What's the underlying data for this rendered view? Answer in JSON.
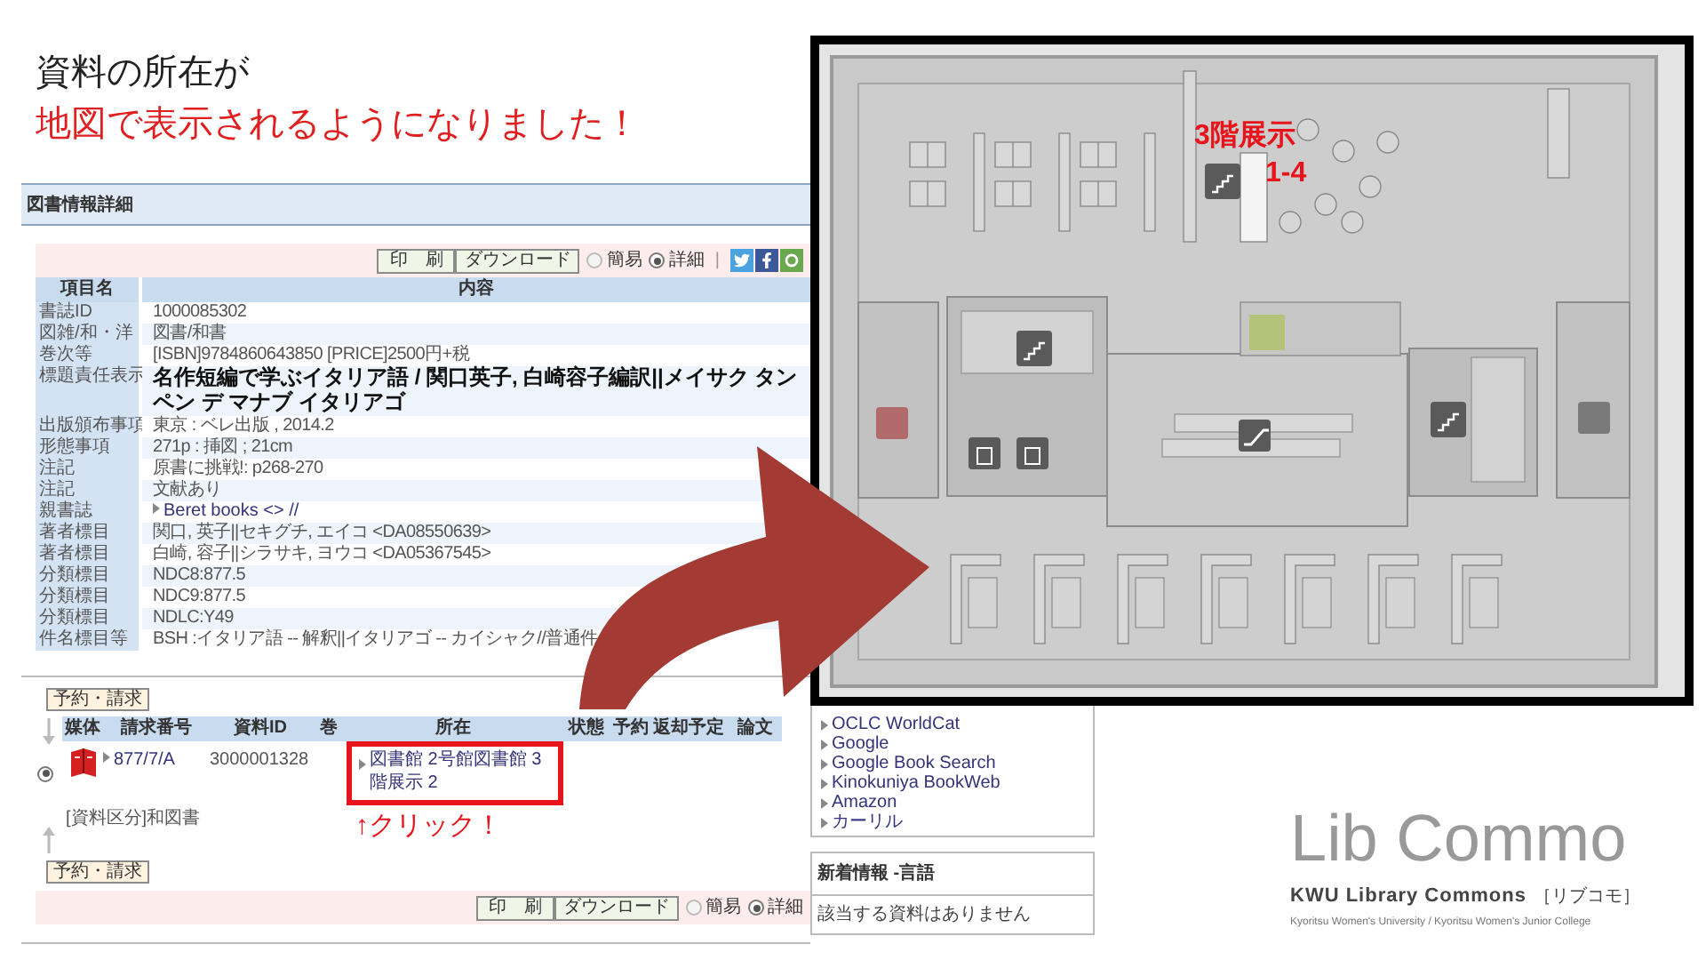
{
  "heading": {
    "line1": "資料の所在が",
    "line2": "地図で表示されるようになりました！"
  },
  "catalog": {
    "title": "図書情報詳細",
    "toolbar": {
      "print": "印　刷",
      "download": "ダウンロード",
      "views": [
        {
          "label": "簡易",
          "selected": false
        },
        {
          "label": "詳細",
          "selected": true
        }
      ],
      "separator": "|"
    },
    "columns": [
      "項目名",
      "内容"
    ],
    "rows": [
      {
        "kind": "text",
        "label": "書誌ID",
        "value": "1000085302"
      },
      {
        "kind": "text",
        "label": "図雑/和・洋",
        "value": "図書/和書"
      },
      {
        "kind": "text",
        "label": "巻次等",
        "value": "[ISBN]9784860643850 [PRICE]2500円+税"
      },
      {
        "kind": "title",
        "label": "標題責任表示",
        "value": "名作短編で学ぶイタリア語 / 関口英子, 白崎容子編訳||メイサク タンペン デ マナブ イタリアゴ"
      },
      {
        "kind": "text",
        "label": "出版頒布事項",
        "value": "東京 : ベレ出版 , 2014.2"
      },
      {
        "kind": "text",
        "label": "形態事項",
        "value": "271p : 挿図 ; 21cm"
      },
      {
        "kind": "text",
        "label": "注記",
        "value": "原書に挑戦!: p268-270"
      },
      {
        "kind": "text",
        "label": "注記",
        "value": "文献あり"
      },
      {
        "kind": "link",
        "label": "親書誌",
        "value": "Beret books <> //"
      },
      {
        "kind": "text",
        "label": "著者標目",
        "value": "関口, 英子||セキグチ, エイコ <DA08550639>"
      },
      {
        "kind": "text",
        "label": "著者標目",
        "value": "白崎, 容子||シラサキ, ヨウコ <DA05367545>"
      },
      {
        "kind": "text",
        "label": "分類標目",
        "value": "NDC8:877.5"
      },
      {
        "kind": "text",
        "label": "分類標目",
        "value": "NDC9:877.5"
      },
      {
        "kind": "text",
        "label": "分類標目",
        "value": "NDLC:Y49"
      },
      {
        "kind": "text",
        "label": "件名標目等",
        "value": "BSH :イタリア語 -- 解釈||イタリアゴ -- カイシャク//普通件"
      }
    ]
  },
  "holdings": {
    "request_button": "予約・請求",
    "columns": [
      "媒体",
      "請求番号",
      "資料ID",
      "巻",
      "所在",
      "状態",
      "予約",
      "返却予定",
      "論文"
    ],
    "rows": [
      {
        "selected": true,
        "call_number": "877/7/A",
        "item_id": "3000001328",
        "location": "図書館 2号館図書館 3階展示 2",
        "category": "[資料区分]和図書"
      }
    ],
    "click_note": "↑クリック！",
    "bottom_request_button": "予約・請求",
    "toolbar": {
      "print": "印　刷",
      "download": "ダウンロード",
      "views": [
        {
          "label": "簡易",
          "selected": false
        },
        {
          "label": "詳細",
          "selected": true
        }
      ]
    }
  },
  "map": {
    "label_line1": "3階展示",
    "label_line2": "1-4"
  },
  "links": [
    "OCLC WorldCat",
    "Google",
    "Google Book Search",
    "Kinokuniya BookWeb",
    "Amazon",
    "カーリル"
  ],
  "news": {
    "title": "新着情報 -言語",
    "message": "該当する資料はありません"
  },
  "logo": {
    "wordmark": "Lib Commo",
    "name": "KWU Library Commons",
    "kana": "［リブコモ］",
    "subtitle": "Kyoritsu Women's University / Kyoritsu Women's Junior College"
  }
}
